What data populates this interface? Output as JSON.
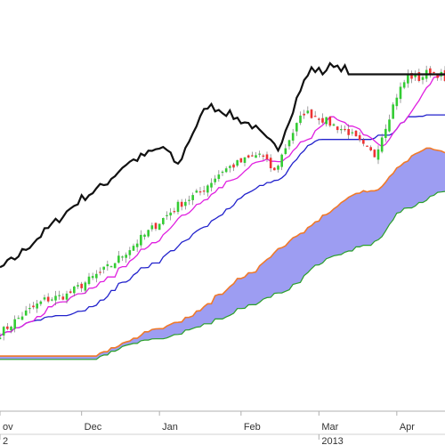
{
  "chart_data": {
    "type": "line",
    "title": "",
    "xlabel": "",
    "ylabel": "",
    "month_labels": [
      {
        "label": "ov",
        "index": 0
      },
      {
        "label": "Dec",
        "index": 22
      },
      {
        "label": "Jan",
        "index": 43
      },
      {
        "label": "Feb",
        "index": 65
      },
      {
        "label": "Mar",
        "index": 86
      },
      {
        "label": "Apr",
        "index": 107
      }
    ],
    "year_labels": [
      {
        "label": "2",
        "index": 0
      },
      {
        "label": "2013",
        "index": 86
      }
    ],
    "series": [
      {
        "kind": "candlestick",
        "color_up": "#33cc33",
        "color_down": "#ee3333",
        "close_anchors": [
          [
            0,
            35
          ],
          [
            6,
            46
          ],
          [
            12,
            55
          ],
          [
            18,
            58
          ],
          [
            24,
            67
          ],
          [
            30,
            76
          ],
          [
            36,
            88
          ],
          [
            42,
            100
          ],
          [
            48,
            112
          ],
          [
            54,
            120
          ],
          [
            60,
            133
          ],
          [
            65,
            138
          ],
          [
            70,
            143
          ],
          [
            74,
            132
          ],
          [
            78,
            152
          ],
          [
            82,
            168
          ],
          [
            86,
            165
          ],
          [
            90,
            160
          ],
          [
            94,
            156
          ],
          [
            98,
            147
          ],
          [
            101,
            142
          ],
          [
            104,
            160
          ],
          [
            107,
            178
          ],
          [
            110,
            190
          ],
          [
            113,
            188
          ],
          [
            116,
            193
          ],
          [
            119,
            190
          ],
          [
            120,
            186
          ]
        ]
      },
      {
        "kind": "line",
        "color": "#111111",
        "values": []
      },
      {
        "kind": "line",
        "color": "#e020e0",
        "values": []
      },
      {
        "kind": "line",
        "color": "#2222cc",
        "values": []
      },
      {
        "kind": "cloud",
        "color": "#8c8cf0",
        "values_a": [],
        "values_b": []
      }
    ],
    "ylim": [
      0,
      230
    ],
    "grid": false
  },
  "colors": {
    "background": "#ffffff",
    "up": "#33cc33",
    "down": "#ee3333",
    "lagging": "#111111",
    "conversion": "#e020e0",
    "base": "#2222cc",
    "cloud_fill": "#8c8cf0",
    "cloud_edge_a": "#f07a2a",
    "cloud_edge_b": "#2aa02a",
    "axis": "#b0b0b0"
  }
}
